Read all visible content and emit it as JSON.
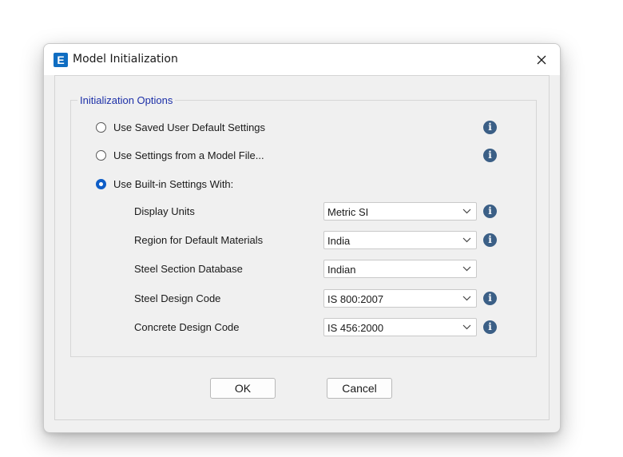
{
  "window": {
    "title": "Model Initialization",
    "app_icon_letter": "E"
  },
  "group": {
    "label": "Initialization Options"
  },
  "options": [
    {
      "label": "Use Saved User Default Settings",
      "selected": false
    },
    {
      "label": "Use Settings from a Model File...",
      "selected": false
    },
    {
      "label": "Use Built-in Settings With:",
      "selected": true
    }
  ],
  "fields": [
    {
      "label": "Display Units",
      "value": "Metric SI"
    },
    {
      "label": "Region for Default Materials",
      "value": "India"
    },
    {
      "label": "Steel Section Database",
      "value": "Indian"
    },
    {
      "label": "Steel Design Code",
      "value": "IS 800:2007"
    },
    {
      "label": "Concrete Design Code",
      "value": "IS 456:2000"
    }
  ],
  "info_glyph": "i",
  "buttons": {
    "ok": "OK",
    "cancel": "Cancel"
  },
  "colors": {
    "accent": "#0f5ec7",
    "group_label": "#1c2fa8",
    "info_icon": "#3b5f86",
    "app_icon": "#0f6dc2"
  }
}
